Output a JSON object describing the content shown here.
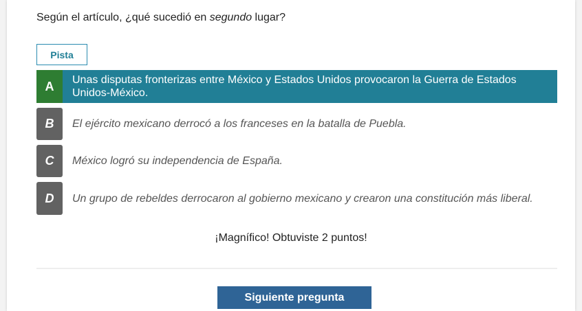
{
  "question": {
    "before": "Según el artículo, ¿qué sucedió en ",
    "emphasis": "segundo",
    "after": " lugar?"
  },
  "hint_label": "Pista",
  "options": [
    {
      "letter": "A",
      "text": "Unas disputas fronterizas entre México y Estados Unidos provocaron la Guerra de Estados Unidos-México.",
      "state": "correct"
    },
    {
      "letter": "B",
      "text": "El ejército mexicano derrocó a los franceses en la batalla de Puebla."
    },
    {
      "letter": "C",
      "text": "México logró su independencia de España."
    },
    {
      "letter": "D",
      "text": "Un grupo de rebeldes derrocaron al gobierno mexicano y crearon una constitución más liberal."
    }
  ],
  "feedback": "¡Magnífico! Obtuviste 2 puntos!",
  "next_label": "Siguiente pregunta",
  "colors": {
    "selected": "#217f96",
    "correct_letter": "#2e7d32",
    "letter": "#626262",
    "button": "#2f6496"
  }
}
